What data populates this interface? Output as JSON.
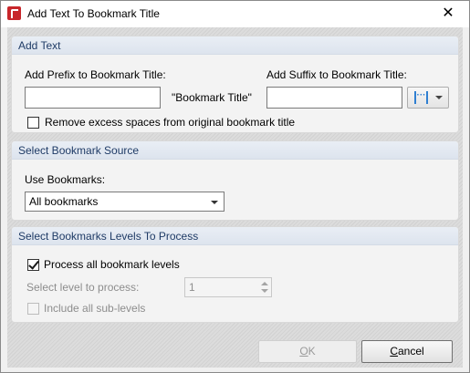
{
  "window": {
    "title": "Add Text To Bookmark Title",
    "close_glyph": "✕"
  },
  "add_text": {
    "section_title": "Add Text",
    "prefix_label": "Add Prefix to Bookmark Title:",
    "prefix_value": "",
    "placeholder_label": "\"Bookmark Title\"",
    "suffix_label": "Add Suffix to Bookmark Title:",
    "suffix_value": "",
    "macro_glyph": "···",
    "remove_spaces_label": "Remove excess spaces from original bookmark title",
    "remove_spaces_checked": false
  },
  "source": {
    "section_title": "Select Bookmark Source",
    "use_bookmarks_label": "Use Bookmarks:",
    "selected": "All bookmarks"
  },
  "levels": {
    "section_title": "Select Bookmarks Levels To Process",
    "process_all_label": "Process all bookmark levels",
    "process_all_checked": true,
    "select_level_label": "Select level to process:",
    "level_value": "1",
    "include_sublevels_label": "Include all sub-levels",
    "include_sublevels_checked": false
  },
  "footer": {
    "ok_label": "OK",
    "ok_accel": "O",
    "ok_rest": "K",
    "cancel_label": "Cancel",
    "cancel_accel": "C",
    "cancel_rest": "ancel"
  },
  "icons": {
    "app": "pdf-app-icon",
    "macro": "macro-insert-icon",
    "dropdown": "chevron-down-icon"
  }
}
